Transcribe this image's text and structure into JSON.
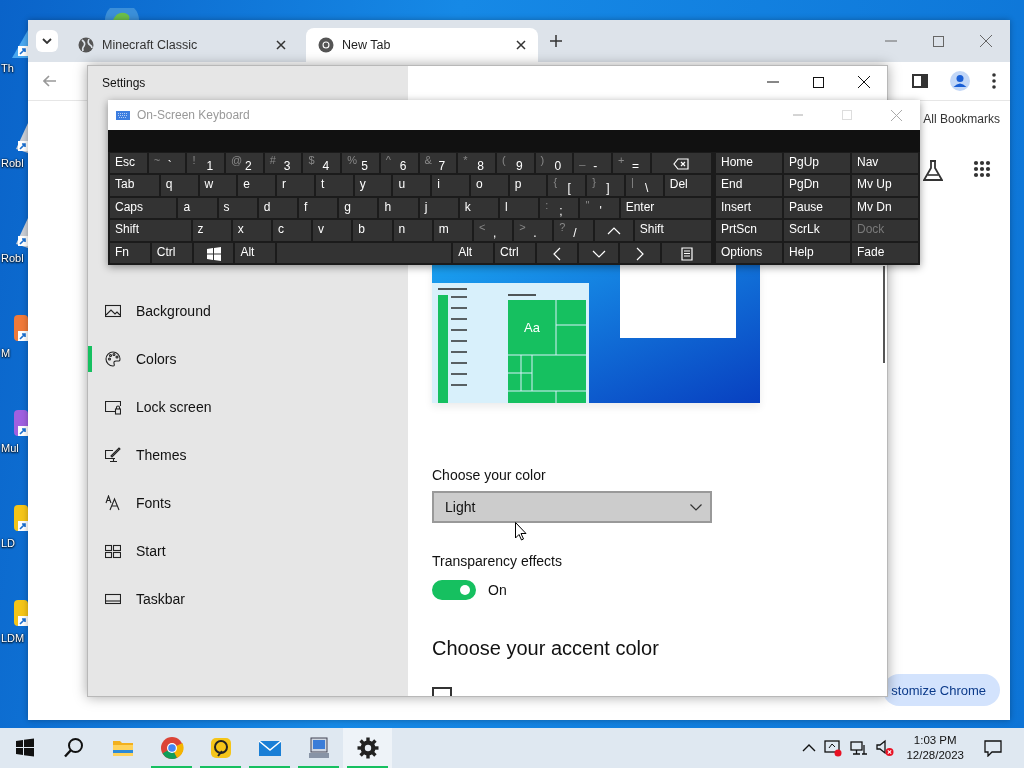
{
  "desktop": {
    "icons": [
      {
        "label": "Th",
        "kind": "triangle"
      },
      {
        "label": "Robl",
        "kind": "roblox"
      },
      {
        "label": "Robl",
        "kind": "roblox"
      },
      {
        "label": "M",
        "kind": "orange"
      },
      {
        "label": "Mul",
        "kind": "purple"
      },
      {
        "label": "LD",
        "kind": "yellow"
      },
      {
        "label": "LDM",
        "kind": "yellow"
      }
    ]
  },
  "browser": {
    "tabs": [
      {
        "title": "Minecraft Classic",
        "kind": "globe",
        "selected": false
      },
      {
        "title": "New Tab",
        "kind": "chrome",
        "selected": true
      }
    ],
    "bookmarks_bar": {
      "label": "All Bookmarks"
    },
    "customize_button": "stomize Chrome"
  },
  "settings": {
    "title": "Settings",
    "nav": [
      {
        "label": "Background",
        "selected": false
      },
      {
        "label": "Colors",
        "selected": true
      },
      {
        "label": "Lock screen",
        "selected": false
      },
      {
        "label": "Themes",
        "selected": false
      },
      {
        "label": "Fonts",
        "selected": false
      },
      {
        "label": "Start",
        "selected": false
      },
      {
        "label": "Taskbar",
        "selected": false
      }
    ],
    "preview": {
      "tile_text": "Aa"
    },
    "color_label": "Choose your color",
    "color_dropdown": {
      "value": "Light"
    },
    "transparency": {
      "label": "Transparency effects",
      "on": true,
      "state_text": "On"
    },
    "accent_heading": "Choose your accent color",
    "auto_accent": {
      "checked": false
    }
  },
  "keyboard": {
    "title": "On-Screen Keyboard",
    "rows": [
      {
        "keys": [
          {
            "kind": "text",
            "label": "Esc"
          },
          {
            "kind": "dual",
            "shift": "~",
            "label": "`"
          },
          {
            "kind": "dual",
            "shift": "!",
            "label": "1"
          },
          {
            "kind": "dual",
            "shift": "@",
            "label": "2"
          },
          {
            "kind": "dual",
            "shift": "#",
            "label": "3"
          },
          {
            "kind": "dual",
            "shift": "$",
            "label": "4"
          },
          {
            "kind": "dual",
            "shift": "%",
            "label": "5"
          },
          {
            "kind": "dual",
            "shift": "^",
            "label": "6"
          },
          {
            "kind": "dual",
            "shift": "&",
            "label": "7"
          },
          {
            "kind": "dual",
            "shift": "*",
            "label": "8"
          },
          {
            "kind": "dual",
            "shift": "(",
            "label": "9"
          },
          {
            "kind": "dual",
            "shift": ")",
            "label": "0"
          },
          {
            "kind": "dual",
            "shift": "_",
            "label": "-"
          },
          {
            "kind": "dual",
            "shift": "+",
            "label": "="
          },
          {
            "kind": "backspace"
          }
        ]
      },
      {
        "keys": [
          {
            "kind": "text",
            "label": "Tab"
          },
          {
            "kind": "text",
            "label": "q"
          },
          {
            "kind": "text",
            "label": "w"
          },
          {
            "kind": "text",
            "label": "e"
          },
          {
            "kind": "text",
            "label": "r"
          },
          {
            "kind": "text",
            "label": "t"
          },
          {
            "kind": "text",
            "label": "y"
          },
          {
            "kind": "text",
            "label": "u"
          },
          {
            "kind": "text",
            "label": "i"
          },
          {
            "kind": "text",
            "label": "o"
          },
          {
            "kind": "text",
            "label": "p"
          },
          {
            "kind": "dual",
            "shift": "{",
            "label": "["
          },
          {
            "kind": "dual",
            "shift": "}",
            "label": "]"
          },
          {
            "kind": "dual",
            "shift": "|",
            "label": "\\"
          },
          {
            "kind": "text",
            "label": "Del"
          }
        ]
      },
      {
        "keys": [
          {
            "kind": "text",
            "label": "Caps"
          },
          {
            "kind": "text",
            "label": "a"
          },
          {
            "kind": "text",
            "label": "s"
          },
          {
            "kind": "text",
            "label": "d"
          },
          {
            "kind": "text",
            "label": "f"
          },
          {
            "kind": "text",
            "label": "g"
          },
          {
            "kind": "text",
            "label": "h"
          },
          {
            "kind": "text",
            "label": "j"
          },
          {
            "kind": "text",
            "label": "k"
          },
          {
            "kind": "text",
            "label": "l"
          },
          {
            "kind": "dual",
            "shift": ":",
            "label": ";"
          },
          {
            "kind": "dual",
            "shift": "\"",
            "label": "'"
          },
          {
            "kind": "text",
            "label": "Enter"
          }
        ]
      },
      {
        "keys": [
          {
            "kind": "text",
            "label": "Shift"
          },
          {
            "kind": "text",
            "label": "z"
          },
          {
            "kind": "text",
            "label": "x"
          },
          {
            "kind": "text",
            "label": "c"
          },
          {
            "kind": "text",
            "label": "v"
          },
          {
            "kind": "text",
            "label": "b"
          },
          {
            "kind": "text",
            "label": "n"
          },
          {
            "kind": "text",
            "label": "m"
          },
          {
            "kind": "dual",
            "shift": "<",
            "label": ","
          },
          {
            "kind": "dual",
            "shift": ">",
            "label": "."
          },
          {
            "kind": "dual",
            "shift": "?",
            "label": "/"
          },
          {
            "kind": "up"
          },
          {
            "kind": "text",
            "label": "Shift"
          }
        ]
      },
      {
        "keys": [
          {
            "kind": "text",
            "label": "Fn"
          },
          {
            "kind": "text",
            "label": "Ctrl"
          },
          {
            "kind": "windows"
          },
          {
            "kind": "text",
            "label": "Alt"
          },
          {
            "kind": "space"
          },
          {
            "kind": "text",
            "label": "Alt"
          },
          {
            "kind": "text",
            "label": "Ctrl"
          },
          {
            "kind": "left"
          },
          {
            "kind": "down"
          },
          {
            "kind": "right"
          },
          {
            "kind": "menu"
          }
        ]
      }
    ],
    "nav_rows": [
      [
        {
          "label": "Home",
          "disabled": false
        },
        {
          "label": "PgUp",
          "disabled": false
        },
        {
          "label": "Nav",
          "disabled": false
        }
      ],
      [
        {
          "label": "End",
          "disabled": false
        },
        {
          "label": "PgDn",
          "disabled": false
        },
        {
          "label": "Mv Up",
          "disabled": false
        }
      ],
      [
        {
          "label": "Insert",
          "disabled": false
        },
        {
          "label": "Pause",
          "disabled": false
        },
        {
          "label": "Mv Dn",
          "disabled": false
        }
      ],
      [
        {
          "label": "PrtScn",
          "disabled": false
        },
        {
          "label": "ScrLk",
          "disabled": false
        },
        {
          "label": "Dock",
          "disabled": true
        }
      ],
      [
        {
          "label": "Options",
          "disabled": false
        },
        {
          "label": "Help",
          "disabled": false
        },
        {
          "label": "Fade",
          "disabled": false
        }
      ]
    ]
  },
  "taskbar": {
    "apps": [
      {
        "kind": "start",
        "running": false,
        "selected": false
      },
      {
        "kind": "search",
        "running": false,
        "selected": false
      },
      {
        "kind": "folder",
        "running": false,
        "selected": false
      },
      {
        "kind": "chrome",
        "running": true,
        "selected": false
      },
      {
        "kind": "ld",
        "running": true,
        "selected": false
      },
      {
        "kind": "mail",
        "running": true,
        "selected": false
      },
      {
        "kind": "remote",
        "running": true,
        "selected": false
      },
      {
        "kind": "settings",
        "running": true,
        "selected": true
      }
    ],
    "time": "1:03 PM",
    "date": "12/28/2023"
  }
}
